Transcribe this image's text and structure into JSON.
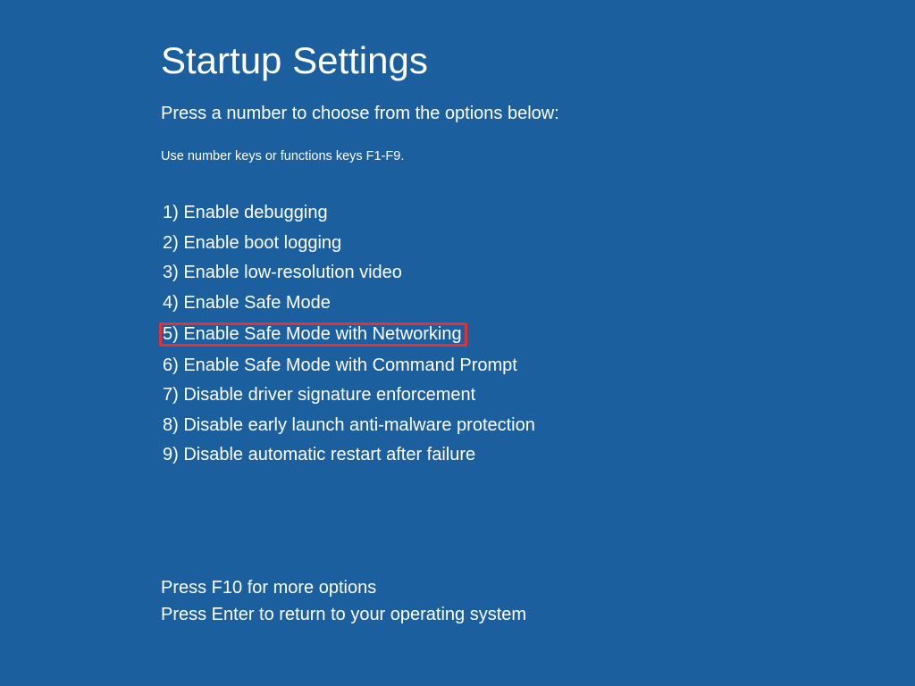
{
  "title": "Startup Settings",
  "subtitle": "Press a number to choose from the options below:",
  "hint": "Use number keys or functions keys F1-F9.",
  "options": [
    {
      "num": "1)",
      "label": "Enable debugging",
      "highlighted": false
    },
    {
      "num": "2)",
      "label": "Enable boot logging",
      "highlighted": false
    },
    {
      "num": "3)",
      "label": "Enable low-resolution video",
      "highlighted": false
    },
    {
      "num": "4)",
      "label": "Enable Safe Mode",
      "highlighted": false
    },
    {
      "num": "5)",
      "label": "Enable Safe Mode with Networking",
      "highlighted": true
    },
    {
      "num": "6)",
      "label": "Enable Safe Mode with Command Prompt",
      "highlighted": false
    },
    {
      "num": "7)",
      "label": "Disable driver signature enforcement",
      "highlighted": false
    },
    {
      "num": "8)",
      "label": "Disable early launch anti-malware protection",
      "highlighted": false
    },
    {
      "num": "9)",
      "label": "Disable automatic restart after failure",
      "highlighted": false
    }
  ],
  "footer": {
    "more": "Press F10 for more options",
    "return": "Press Enter to return to your operating system"
  },
  "colors": {
    "background": "#1B5F9E",
    "text": "#FFFFFF",
    "highlight_border": "#E53131"
  }
}
